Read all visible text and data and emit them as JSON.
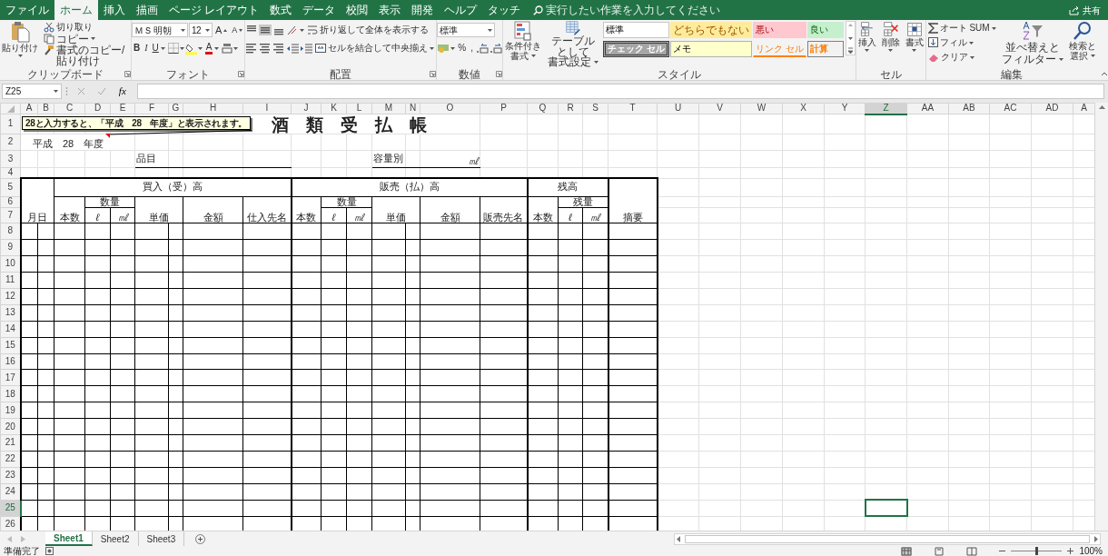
{
  "menu_tabs": [
    {
      "label": "ファイル",
      "selected": false
    },
    {
      "label": "ホーム",
      "selected": true
    },
    {
      "label": "挿入",
      "selected": false
    },
    {
      "label": "描画",
      "selected": false
    },
    {
      "label": "ページ レイアウト",
      "selected": false
    },
    {
      "label": "数式",
      "selected": false
    },
    {
      "label": "データ",
      "selected": false
    },
    {
      "label": "校閲",
      "selected": false
    },
    {
      "label": "表示",
      "selected": false
    },
    {
      "label": "開発",
      "selected": false
    },
    {
      "label": "ヘルプ",
      "selected": false
    },
    {
      "label": "タッチ",
      "selected": false
    }
  ],
  "tell_me": {
    "placeholder": "実行したい作業を入力してください"
  },
  "share": "共有",
  "clipboard": {
    "label": "クリップボード",
    "paste": "貼り付け",
    "cut": "切り取り",
    "copy": "コピー",
    "format_painter": "書式のコピー/貼り付け"
  },
  "font": {
    "label": "フォント",
    "font_name": "ＭＳ 明朝",
    "font_size": "12",
    "grow": "A",
    "shrink": "A",
    "bold": "B",
    "italic": "I",
    "underline": "U",
    "font_color": "A"
  },
  "alignment": {
    "label": "配置",
    "vertical": [
      {
        "kind": "top",
        "selected": false
      },
      {
        "kind": "middle",
        "selected": true
      },
      {
        "kind": "bottom",
        "selected": false
      }
    ],
    "wrap_text": "折り返して全体を表示する",
    "merge_center": "セルを結合して中央揃え"
  },
  "number": {
    "label": "数値",
    "format": "標準",
    "percent": "%",
    "comma": ","
  },
  "styles": {
    "label": "スタイル",
    "conditional": [
      "条件付き",
      "書式"
    ],
    "format_table": [
      "テーブルとして",
      "書式設定"
    ],
    "gallery": [
      {
        "label": "標準",
        "kind": "normal"
      },
      {
        "label": "どちらでもない",
        "kind": "neutral"
      },
      {
        "label": "悪い",
        "kind": "bad"
      },
      {
        "label": "良い",
        "kind": "good"
      },
      {
        "label": "チェック セル",
        "kind": "check"
      },
      {
        "label": "メモ",
        "kind": "note"
      },
      {
        "label": "リンク セル",
        "kind": "linked"
      },
      {
        "label": "計算",
        "kind": "calc"
      }
    ]
  },
  "cells_group": {
    "label": "セル",
    "insert": "挿入",
    "delete": "削除",
    "format": "書式"
  },
  "editing": {
    "label": "編集",
    "autosum": "オート SUM",
    "fill": "フィル",
    "clear": "クリア",
    "sort": [
      "並べ替えと",
      "フィルター"
    ],
    "find": [
      "検索と",
      "選択"
    ]
  },
  "formula_bar": {
    "name_box": "Z25",
    "function_label": "fx"
  },
  "sheet": {
    "columns": [
      {
        "label": "A",
        "selected": false
      },
      {
        "label": "B",
        "selected": false
      },
      {
        "label": "C",
        "selected": false
      },
      {
        "label": "D",
        "selected": false
      },
      {
        "label": "E",
        "selected": false
      },
      {
        "label": "F",
        "selected": false
      },
      {
        "label": "G",
        "selected": false
      },
      {
        "label": "H",
        "selected": false
      },
      {
        "label": "I",
        "selected": false
      },
      {
        "label": "J",
        "selected": false
      },
      {
        "label": "K",
        "selected": false
      },
      {
        "label": "L",
        "selected": false
      },
      {
        "label": "M",
        "selected": false
      },
      {
        "label": "N",
        "selected": false
      },
      {
        "label": "O",
        "selected": false
      },
      {
        "label": "P",
        "selected": false
      },
      {
        "label": "Q",
        "selected": false
      },
      {
        "label": "R",
        "selected": false
      },
      {
        "label": "S",
        "selected": false
      },
      {
        "label": "T",
        "selected": false
      },
      {
        "label": "U",
        "selected": false
      },
      {
        "label": "V",
        "selected": false
      },
      {
        "label": "W",
        "selected": false
      },
      {
        "label": "X",
        "selected": false
      },
      {
        "label": "Y",
        "selected": false
      },
      {
        "label": "Z",
        "selected": true
      },
      {
        "label": "AA",
        "selected": false
      },
      {
        "label": "AB",
        "selected": false
      },
      {
        "label": "AC",
        "selected": false
      },
      {
        "label": "AD",
        "selected": false
      },
      {
        "label": "A",
        "selected": false
      }
    ],
    "rows": [
      {
        "label": "1",
        "selected": false
      },
      {
        "label": "2",
        "selected": false
      },
      {
        "label": "3",
        "selected": false
      },
      {
        "label": "4",
        "selected": false
      },
      {
        "label": "5",
        "selected": false
      },
      {
        "label": "6",
        "selected": false
      },
      {
        "label": "7",
        "selected": false
      },
      {
        "label": "8",
        "selected": false
      },
      {
        "label": "9",
        "selected": false
      },
      {
        "label": "10",
        "selected": false
      },
      {
        "label": "11",
        "selected": false
      },
      {
        "label": "12",
        "selected": false
      },
      {
        "label": "13",
        "selected": false
      },
      {
        "label": "14",
        "selected": false
      },
      {
        "label": "15",
        "selected": false
      },
      {
        "label": "16",
        "selected": false
      },
      {
        "label": "17",
        "selected": false
      },
      {
        "label": "18",
        "selected": false
      },
      {
        "label": "19",
        "selected": false
      },
      {
        "label": "20",
        "selected": false
      },
      {
        "label": "21",
        "selected": false
      },
      {
        "label": "22",
        "selected": false
      },
      {
        "label": "23",
        "selected": false
      },
      {
        "label": "24",
        "selected": false
      },
      {
        "label": "25",
        "selected": true
      },
      {
        "label": "26",
        "selected": false
      }
    ]
  },
  "ledger": {
    "title": "酒　類　受　払　帳",
    "era": "平成　28　年度",
    "item_label": "品目",
    "capacity_label": "容量別",
    "capacity_unit": "㎖",
    "date_header": "月日",
    "sections": [
      {
        "title": "買入（受）高",
        "count": "本数",
        "quantity": "数量",
        "liter": "ℓ",
        "ml": "㎖",
        "unit_price": "単価",
        "amount": "金額",
        "party": "仕入先名"
      },
      {
        "title": "販売（払）高",
        "count": "本数",
        "quantity": "数量",
        "liter": "ℓ",
        "ml": "㎖",
        "unit_price": "単価",
        "amount": "金額",
        "party": "販売先名"
      }
    ],
    "balance": {
      "title": "残高",
      "count": "本数",
      "quantity": "残量",
      "liter": "ℓ",
      "ml": "㎖"
    },
    "remarks": "摘要"
  },
  "comment": "28と入力すると、「平成　28　年度」と表示されます。",
  "sheet_tabs": [
    {
      "label": "Sheet1",
      "selected": true
    },
    {
      "label": "Sheet2",
      "selected": false
    },
    {
      "label": "Sheet3",
      "selected": false
    }
  ],
  "status_bar": {
    "text": "準備完了",
    "views": [
      {
        "kind": "normal",
        "selected": true
      },
      {
        "kind": "page_layout",
        "selected": false
      },
      {
        "kind": "page_break",
        "selected": false
      }
    ],
    "zoom": {
      "label": "100%",
      "level": 0.5
    }
  }
}
